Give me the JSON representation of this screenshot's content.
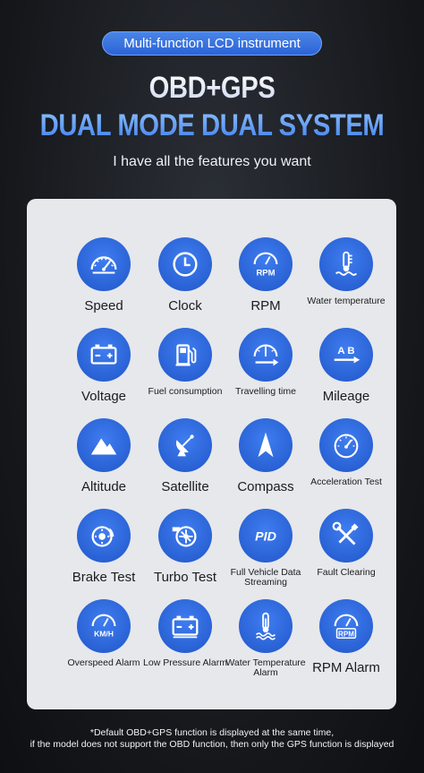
{
  "header": {
    "pill": "Multi-function LCD instrument",
    "headline_line1": "OBD+GPS",
    "headline_line2": "DUAL MODE DUAL SYSTEM",
    "subtitle": "I have all the features you want"
  },
  "features": [
    {
      "label": "Speed",
      "icon": "speedometer-icon",
      "size": "big"
    },
    {
      "label": "Clock",
      "icon": "clock-icon",
      "size": "big"
    },
    {
      "label": "RPM",
      "icon": "rpm-gauge-icon",
      "icon_text": "RPM",
      "size": "big"
    },
    {
      "label": "Water temperature",
      "icon": "water-temperature-icon",
      "size": "small"
    },
    {
      "label": "Voltage",
      "icon": "battery-icon",
      "size": "big"
    },
    {
      "label": "Fuel consumption",
      "icon": "fuel-pump-icon",
      "size": "small"
    },
    {
      "label": "Travelling time",
      "icon": "travel-time-gauge-icon",
      "size": "small"
    },
    {
      "label": "Mileage",
      "icon": "mileage-a-b-icon",
      "icon_text": "A B",
      "size": "big"
    },
    {
      "label": "Altitude",
      "icon": "mountain-icon",
      "size": "big"
    },
    {
      "label": "Satellite",
      "icon": "satellite-dish-icon",
      "size": "big"
    },
    {
      "label": "Compass",
      "icon": "compass-needle-icon",
      "size": "big"
    },
    {
      "label": "Acceleration Test",
      "icon": "acceleration-gauge-icon",
      "size": "small"
    },
    {
      "label": "Brake Test",
      "icon": "brake-disc-icon",
      "size": "big"
    },
    {
      "label": "Turbo Test",
      "icon": "turbo-icon",
      "size": "big"
    },
    {
      "label": "Full Vehicle Data Streaming",
      "icon": "pid-icon",
      "icon_text": "PID",
      "size": "small"
    },
    {
      "label": "Fault Clearing",
      "icon": "wrench-screwdriver-icon",
      "size": "small"
    },
    {
      "label": "Overspeed Alarm",
      "icon": "kmh-gauge-icon",
      "icon_text": "KM/H",
      "size": "small"
    },
    {
      "label": "Low Pressure Alarm",
      "icon": "low-battery-icon",
      "size": "small"
    },
    {
      "label": "Water Temperature Alarm",
      "icon": "water-temperature-alarm-icon",
      "size": "small"
    },
    {
      "label": "RPM Alarm",
      "icon": "rpm-alarm-icon",
      "icon_text": "RPM",
      "size": "big"
    }
  ],
  "footnote": {
    "line1": "*Default OBD+GPS function is displayed at the same time,",
    "line2": "if the model does not support the OBD function, then only the GPS function is displayed"
  },
  "colors": {
    "icon_blue": "#2c66d8",
    "panel": "#e6e8ec",
    "pill": "#3a74e2",
    "headline_blue": "#5b9af5"
  }
}
